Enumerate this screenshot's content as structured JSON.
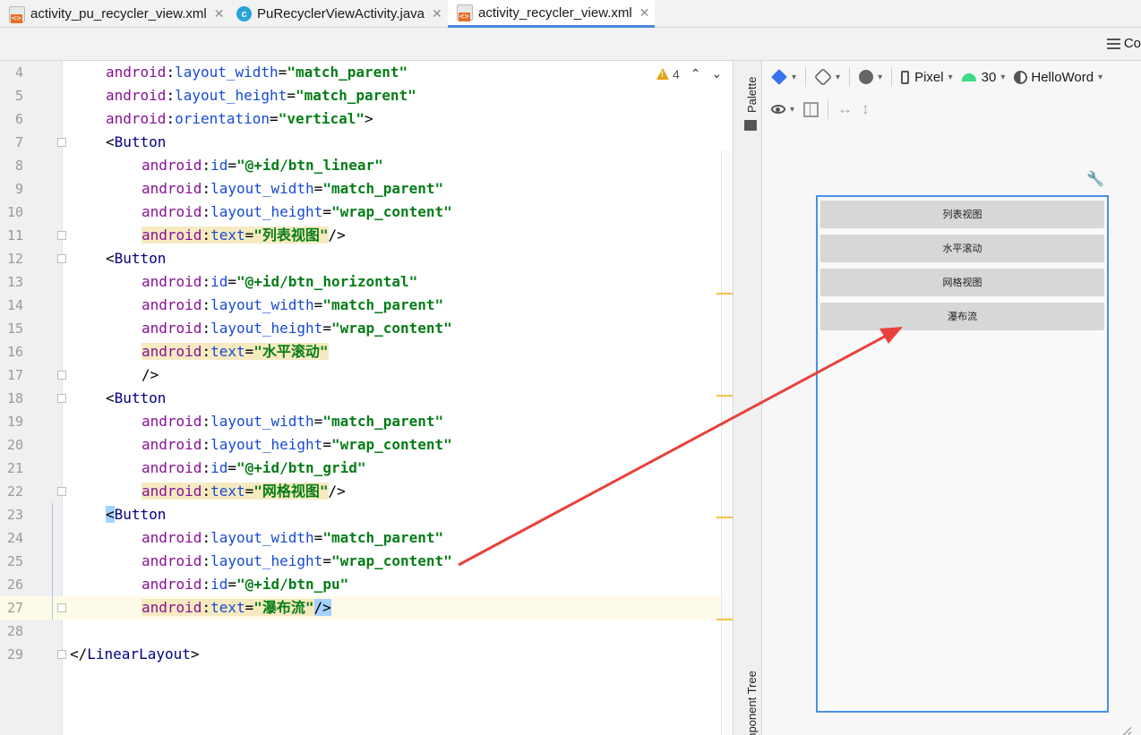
{
  "tabs": [
    {
      "label": "activity_pu_recycler_view.xml",
      "icon": "xml-file-icon",
      "active": false
    },
    {
      "label": "PuRecyclerViewActivity.java",
      "icon": "java-class-icon",
      "active": false
    },
    {
      "label": "activity_recycler_view.xml",
      "icon": "xml-file-icon",
      "active": true
    }
  ],
  "secondbar": {
    "code_toggle_label": "Co"
  },
  "editor": {
    "inspection": {
      "warning_count": "4"
    },
    "lines": [
      {
        "num": "4",
        "indent": 1,
        "tokens": [
          {
            "t": "ns",
            "v": "android"
          },
          {
            "t": "plain",
            "v": ":"
          },
          {
            "t": "attr",
            "v": "layout_width"
          },
          {
            "t": "plain",
            "v": "="
          },
          {
            "t": "val",
            "v": "\"match_parent\""
          }
        ]
      },
      {
        "num": "5",
        "indent": 1,
        "tokens": [
          {
            "t": "ns",
            "v": "android"
          },
          {
            "t": "plain",
            "v": ":"
          },
          {
            "t": "attr",
            "v": "layout_height"
          },
          {
            "t": "plain",
            "v": "="
          },
          {
            "t": "val",
            "v": "\"match_parent\""
          }
        ]
      },
      {
        "num": "6",
        "indent": 1,
        "tokens": [
          {
            "t": "ns",
            "v": "android"
          },
          {
            "t": "plain",
            "v": ":"
          },
          {
            "t": "attr",
            "v": "orientation"
          },
          {
            "t": "plain",
            "v": "="
          },
          {
            "t": "val",
            "v": "\"vertical\""
          },
          {
            "t": "plain",
            "v": ">"
          }
        ]
      },
      {
        "num": "7",
        "indent": 1,
        "fold": true,
        "tokens": [
          {
            "t": "plain",
            "v": "<"
          },
          {
            "t": "tag",
            "v": "Button"
          }
        ]
      },
      {
        "num": "8",
        "indent": 2,
        "tokens": [
          {
            "t": "ns",
            "v": "android"
          },
          {
            "t": "plain",
            "v": ":"
          },
          {
            "t": "attr",
            "v": "id"
          },
          {
            "t": "plain",
            "v": "="
          },
          {
            "t": "val",
            "v": "\"@+id/btn_linear\""
          }
        ]
      },
      {
        "num": "9",
        "indent": 2,
        "tokens": [
          {
            "t": "ns",
            "v": "android"
          },
          {
            "t": "plain",
            "v": ":"
          },
          {
            "t": "attr",
            "v": "layout_width"
          },
          {
            "t": "plain",
            "v": "="
          },
          {
            "t": "val",
            "v": "\"match_parent\""
          }
        ]
      },
      {
        "num": "10",
        "indent": 2,
        "tokens": [
          {
            "t": "ns",
            "v": "android"
          },
          {
            "t": "plain",
            "v": ":"
          },
          {
            "t": "attr",
            "v": "layout_height"
          },
          {
            "t": "plain",
            "v": "="
          },
          {
            "t": "val",
            "v": "\"wrap_content\""
          }
        ]
      },
      {
        "num": "11",
        "indent": 2,
        "fold": true,
        "hl": true,
        "tokens": [
          {
            "t": "ns",
            "v": "android"
          },
          {
            "t": "plain",
            "v": ":"
          },
          {
            "t": "attr",
            "v": "text"
          },
          {
            "t": "plain",
            "v": "="
          },
          {
            "t": "val",
            "v": "\"列表视图\""
          },
          {
            "t": "plain",
            "v": "/>"
          }
        ]
      },
      {
        "num": "12",
        "indent": 1,
        "fold": true,
        "tokens": [
          {
            "t": "plain",
            "v": "<"
          },
          {
            "t": "tag",
            "v": "Button"
          }
        ]
      },
      {
        "num": "13",
        "indent": 2,
        "tokens": [
          {
            "t": "ns",
            "v": "android"
          },
          {
            "t": "plain",
            "v": ":"
          },
          {
            "t": "attr",
            "v": "id"
          },
          {
            "t": "plain",
            "v": "="
          },
          {
            "t": "val",
            "v": "\"@+id/btn_horizontal\""
          }
        ]
      },
      {
        "num": "14",
        "indent": 2,
        "tokens": [
          {
            "t": "ns",
            "v": "android"
          },
          {
            "t": "plain",
            "v": ":"
          },
          {
            "t": "attr",
            "v": "layout_width"
          },
          {
            "t": "plain",
            "v": "="
          },
          {
            "t": "val",
            "v": "\"match_parent\""
          }
        ]
      },
      {
        "num": "15",
        "indent": 2,
        "tokens": [
          {
            "t": "ns",
            "v": "android"
          },
          {
            "t": "plain",
            "v": ":"
          },
          {
            "t": "attr",
            "v": "layout_height"
          },
          {
            "t": "plain",
            "v": "="
          },
          {
            "t": "val",
            "v": "\"wrap_content\""
          }
        ]
      },
      {
        "num": "16",
        "indent": 2,
        "hl": true,
        "tokens": [
          {
            "t": "ns",
            "v": "android"
          },
          {
            "t": "plain",
            "v": ":"
          },
          {
            "t": "attr",
            "v": "text"
          },
          {
            "t": "plain",
            "v": "="
          },
          {
            "t": "val",
            "v": "\"水平滚动\""
          }
        ]
      },
      {
        "num": "17",
        "indent": 2,
        "fold": true,
        "tokens": [
          {
            "t": "plain",
            "v": "/>"
          }
        ]
      },
      {
        "num": "18",
        "indent": 1,
        "fold": true,
        "tokens": [
          {
            "t": "plain",
            "v": "<"
          },
          {
            "t": "tag",
            "v": "Button"
          }
        ]
      },
      {
        "num": "19",
        "indent": 2,
        "tokens": [
          {
            "t": "ns",
            "v": "android"
          },
          {
            "t": "plain",
            "v": ":"
          },
          {
            "t": "attr",
            "v": "layout_width"
          },
          {
            "t": "plain",
            "v": "="
          },
          {
            "t": "val",
            "v": "\"match_parent\""
          }
        ]
      },
      {
        "num": "20",
        "indent": 2,
        "tokens": [
          {
            "t": "ns",
            "v": "android"
          },
          {
            "t": "plain",
            "v": ":"
          },
          {
            "t": "attr",
            "v": "layout_height"
          },
          {
            "t": "plain",
            "v": "="
          },
          {
            "t": "val",
            "v": "\"wrap_content\""
          }
        ]
      },
      {
        "num": "21",
        "indent": 2,
        "tokens": [
          {
            "t": "ns",
            "v": "android"
          },
          {
            "t": "plain",
            "v": ":"
          },
          {
            "t": "attr",
            "v": "id"
          },
          {
            "t": "plain",
            "v": "="
          },
          {
            "t": "val",
            "v": "\"@+id/btn_grid\""
          }
        ]
      },
      {
        "num": "22",
        "indent": 2,
        "fold": true,
        "hl": true,
        "tokens": [
          {
            "t": "ns",
            "v": "android"
          },
          {
            "t": "plain",
            "v": ":"
          },
          {
            "t": "attr",
            "v": "text"
          },
          {
            "t": "plain",
            "v": "="
          },
          {
            "t": "val",
            "v": "\"网格视图\""
          },
          {
            "t": "plain",
            "v": "/>"
          }
        ]
      },
      {
        "num": "23",
        "indent": 1,
        "caretTag": true,
        "tokens": [
          {
            "t": "caret",
            "v": "<"
          },
          {
            "t": "tag",
            "v": "Button"
          }
        ]
      },
      {
        "num": "24",
        "indent": 2,
        "tokens": [
          {
            "t": "ns",
            "v": "android"
          },
          {
            "t": "plain",
            "v": ":"
          },
          {
            "t": "attr",
            "v": "layout_width"
          },
          {
            "t": "plain",
            "v": "="
          },
          {
            "t": "val",
            "v": "\"match_parent\""
          }
        ]
      },
      {
        "num": "25",
        "indent": 2,
        "tokens": [
          {
            "t": "ns",
            "v": "android"
          },
          {
            "t": "plain",
            "v": ":"
          },
          {
            "t": "attr",
            "v": "layout_height"
          },
          {
            "t": "plain",
            "v": "="
          },
          {
            "t": "val",
            "v": "\"wrap_content\""
          }
        ]
      },
      {
        "num": "26",
        "indent": 2,
        "tokens": [
          {
            "t": "ns",
            "v": "android"
          },
          {
            "t": "plain",
            "v": ":"
          },
          {
            "t": "attr",
            "v": "id"
          },
          {
            "t": "plain",
            "v": "="
          },
          {
            "t": "val",
            "v": "\"@+id/btn_pu\""
          }
        ]
      },
      {
        "num": "27",
        "indent": 2,
        "fold": true,
        "current": true,
        "hl": true,
        "tokens": [
          {
            "t": "ns",
            "v": "android"
          },
          {
            "t": "plain",
            "v": ":"
          },
          {
            "t": "attr",
            "v": "text"
          },
          {
            "t": "plain",
            "v": "="
          },
          {
            "t": "val",
            "v": "\"瀑布流\""
          },
          {
            "t": "caret",
            "v": "/>"
          }
        ]
      },
      {
        "num": "28",
        "indent": 0,
        "tokens": []
      },
      {
        "num": "29",
        "indent": 0,
        "fold": true,
        "tokens": [
          {
            "t": "plain",
            "v": "</"
          },
          {
            "t": "tag",
            "v": "LinearLayout"
          },
          {
            "t": "plain",
            "v": ">"
          }
        ]
      }
    ]
  },
  "side": {
    "palette_label": "Palette",
    "component_tree_label": "Component Tree"
  },
  "design": {
    "device_label": "Pixel",
    "api_label": "30",
    "theme_label": "HelloWord",
    "preview_buttons": [
      "列表视图",
      "水平滚动",
      "网格视图",
      "瀑布流"
    ]
  },
  "annotation": {
    "arrow_color": "#e8413c"
  }
}
